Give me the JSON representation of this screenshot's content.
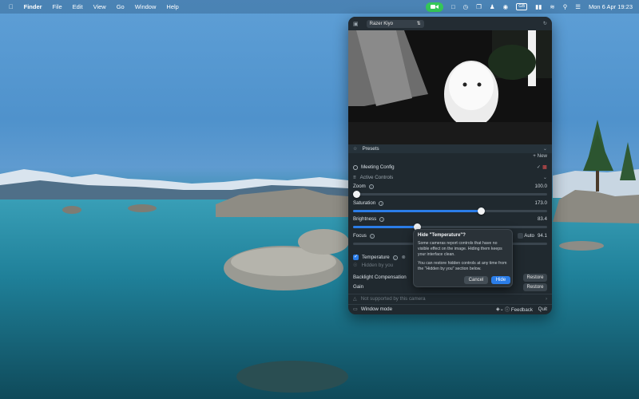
{
  "menubar": {
    "app": "Finder",
    "items": [
      "File",
      "Edit",
      "View",
      "Go",
      "Window",
      "Help"
    ],
    "status_badge": "GB",
    "datetime": "Mon 6 Apr  19:23"
  },
  "panel": {
    "camera": "Razer Kiyo",
    "presets": "Presets",
    "new": "+ New",
    "preset_name": "Meeting Config",
    "active_controls": "Active Controls",
    "controls": [
      {
        "label": "Zoom",
        "value": "100.0",
        "fraction": 0.02
      },
      {
        "label": "Saturation",
        "value": "173.0",
        "fraction": 0.66
      },
      {
        "label": "Brightness",
        "value": "83.4",
        "fraction": 0.33
      },
      {
        "label": "Focus",
        "value": "94.1",
        "auto": "Auto"
      }
    ],
    "temperature": "Temperature",
    "hidden_by_you": "Hidden by you",
    "backlight": "Backlight Compensation",
    "gain": "Gain",
    "restore": "Restore",
    "not_supported": "Not supported by this camera",
    "window_mode": "Window mode",
    "feedback": "Feedback",
    "quit": "Quit"
  },
  "popover": {
    "title": "Hide \"Temperature\"?",
    "body1": "Some cameras report controls that have no visible effect on the image. Hiding them keeps your interface clean.",
    "body2": "You can restore hidden controls at any time from the \"Hidden by you\" section below.",
    "cancel": "Cancel",
    "hide": "Hide"
  },
  "colors": {
    "accent": "#2b7de8",
    "facetime": "#35c759",
    "panel": "#20292f"
  }
}
